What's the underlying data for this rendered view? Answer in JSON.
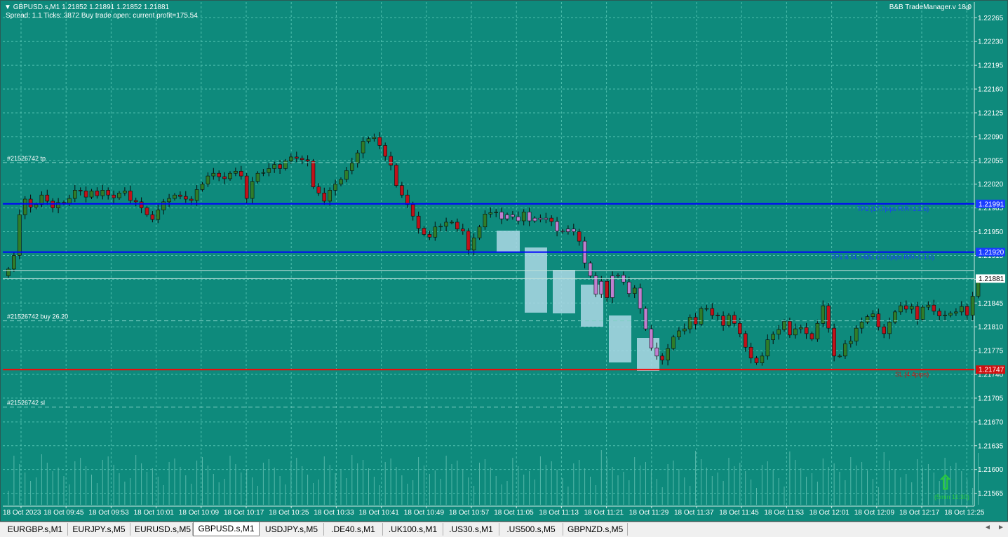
{
  "header": {
    "collapse_glyph": "▼",
    "symbol_line": "GBPUSD.s,M1  1.21852 1.21891 1.21852 1.21881",
    "info_line": "Spread: 1.1   Ticks: 3872   Buy trade open: current profit=175.54"
  },
  "trade_manager": {
    "title": "B&B TradeManager.v 18.0",
    "smile_glyph": "☺"
  },
  "colors": {
    "background": "#0e8a7c",
    "grid": "#4fbfae",
    "axis_line": "#cfe9e4",
    "bull": "#2f7d2a",
    "bear": "#c0121a",
    "wick": "#0a0a0a",
    "tp_line": "#0000ff",
    "sl_line": "#ff0000",
    "highlight_box": "#add8e6",
    "highlight_candle": "#c07fd0",
    "volume": "#57b8aa",
    "signal_arrow": "#28c840"
  },
  "chart_data": {
    "type": "candlestick",
    "symbol": "GBPUSD.s",
    "timeframe": "M1",
    "ylim": [
      1.21546,
      1.22288
    ],
    "yticks": [
      "1.22265",
      "1.22230",
      "1.22195",
      "1.22160",
      "1.22125",
      "1.22090",
      "1.22055",
      "1.22020",
      "1.21985",
      "1.21950",
      "1.21915",
      "1.21880",
      "1.21845",
      "1.21810",
      "1.21775",
      "1.21740",
      "1.21705",
      "1.21670",
      "1.21635",
      "1.21600",
      "1.21565"
    ],
    "xticks": [
      "18 Oct 2023",
      "18 Oct 09:45",
      "18 Oct 09:53",
      "18 Oct 10:01",
      "18 Oct 10:09",
      "18 Oct 10:17",
      "18 Oct 10:25",
      "18 Oct 10:33",
      "18 Oct 10:41",
      "18 Oct 10:49",
      "18 Oct 10:57",
      "18 Oct 11:05",
      "18 Oct 11:13",
      "18 Oct 11:21",
      "18 Oct 11:29",
      "18 Oct 11:37",
      "18 Oct 11:45",
      "18 Oct 11:53",
      "18 Oct 12:01",
      "18 Oct 12:09",
      "18 Oct 12:17",
      "18 Oct 12:25"
    ],
    "closes": [
      1.21895,
      1.21915,
      1.21975,
      1.21998,
      1.21986,
      1.2199,
      1.22004,
      1.21995,
      1.21985,
      1.21993,
      1.21992,
      1.21999,
      1.22011,
      1.2201,
      1.22001,
      1.2201,
      1.22003,
      1.22011,
      1.22004,
      1.22,
      1.22007,
      1.2201,
      1.21996,
      1.21994,
      1.21985,
      1.21975,
      1.21968,
      1.21982,
      1.21994,
      1.21999,
      1.22004,
      1.22002,
      1.21998,
      1.21996,
      1.22012,
      1.2202,
      1.22032,
      1.22036,
      1.22031,
      1.22028,
      1.22036,
      1.22039,
      1.22032,
      1.21999,
      1.22024,
      1.22036,
      1.22037,
      1.22043,
      1.22049,
      1.22043,
      1.22054,
      1.2206,
      1.22058,
      1.22056,
      1.22054,
      1.22016,
      1.22007,
      1.21995,
      1.22011,
      1.2202,
      1.22027,
      1.2204,
      1.22051,
      1.22066,
      1.22083,
      1.22087,
      1.22089,
      1.22077,
      1.22061,
      1.22048,
      1.22018,
      1.22004,
      1.2199,
      1.21973,
      1.21955,
      1.21946,
      1.21942,
      1.21957,
      1.21958,
      1.21964,
      1.21964,
      1.21954,
      1.21951,
      1.21923,
      1.21941,
      1.21957,
      1.21976,
      1.21978,
      1.21979,
      1.21969,
      1.21975,
      1.21972,
      1.21966,
      1.21979,
      1.21966,
      1.2197,
      1.21968,
      1.2197,
      1.21965,
      1.21951,
      1.2195,
      1.21954,
      1.2195,
      1.21936,
      1.21904,
      1.21885,
      1.21858,
      1.21877,
      1.21853,
      1.21885,
      1.21886,
      1.21876,
      1.21859,
      1.21867,
      1.21837,
      1.21807,
      1.21779,
      1.21767,
      1.21761,
      1.21778,
      1.21795,
      1.21804,
      1.21807,
      1.21824,
      1.21814,
      1.21837,
      1.21837,
      1.21827,
      1.21826,
      1.21812,
      1.21827,
      1.21815,
      1.218,
      1.2178,
      1.21764,
      1.21757,
      1.21767,
      1.21791,
      1.21799,
      1.21806,
      1.21818,
      1.21798,
      1.21807,
      1.21809,
      1.218,
      1.21792,
      1.21815,
      1.21841,
      1.21808,
      1.21767,
      1.21767,
      1.21785,
      1.21789,
      1.21808,
      1.21817,
      1.21825,
      1.21829,
      1.2181,
      1.218,
      1.21817,
      1.21832,
      1.21841,
      1.21836,
      1.2184,
      1.21821,
      1.21839,
      1.21842,
      1.21833,
      1.21826,
      1.21827,
      1.2183,
      1.21832,
      1.2184,
      1.21827,
      1.21855,
      1.21881
    ],
    "volume_note": "tick volume histogram along bottom",
    "levels": [
      {
        "price": 1.21991,
        "label": "1.21991",
        "desc": "TP2 (17.7pips R/R=1:2.6)",
        "style": "tp"
      },
      {
        "price": 1.2192,
        "label": "1.21920",
        "desc": "TP1 & SL->B/E (10.6pips R/R=1:1.6)",
        "style": "tp"
      },
      {
        "price": 1.21881,
        "label": "1.21881",
        "desc": "",
        "style": "bid"
      },
      {
        "price": 1.21747,
        "label": "1.21747",
        "desc": "SL (4.4pips)",
        "style": "sl"
      }
    ],
    "order_labels": [
      {
        "price": 1.22058,
        "text": "#21526742 tp"
      },
      {
        "price": 1.21825,
        "text": "#21526742 buy 26.20"
      },
      {
        "price": 1.21698,
        "text": "#21526742 sl"
      }
    ],
    "signal": {
      "text": "(5min 11:30)",
      "glyph": "⇧"
    }
  },
  "tabs": [
    {
      "label": "EURGBP.s,M1",
      "active": false
    },
    {
      "label": "EURJPY.s,M5",
      "active": false
    },
    {
      "label": "EURUSD.s,M5",
      "active": false
    },
    {
      "label": "GBPUSD.s,M1",
      "active": true
    },
    {
      "label": "USDJPY.s,M5",
      "active": false
    },
    {
      "label": ".DE40.s,M1",
      "active": false
    },
    {
      "label": ".UK100.s,M1",
      "active": false
    },
    {
      "label": ".US30.s,M1",
      "active": false
    },
    {
      "label": ".US500.s,M5",
      "active": false
    },
    {
      "label": "GBPNZD.s,M5",
      "active": false
    }
  ],
  "tab_nav": {
    "left": "◄",
    "right": "►"
  }
}
